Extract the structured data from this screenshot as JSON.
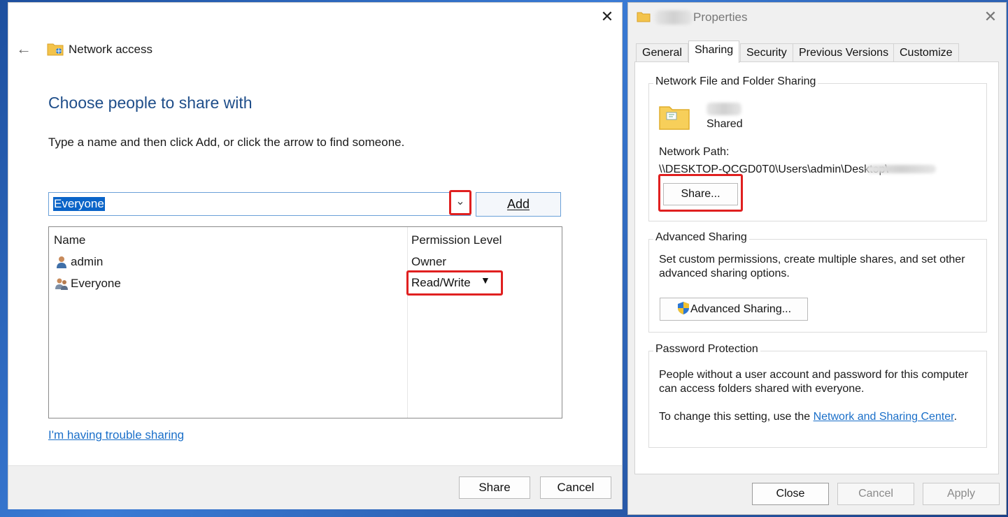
{
  "network_access": {
    "title": "Network access",
    "heading": "Choose people to share with",
    "instruction": "Type a name and then click Add, or click the arrow to find someone.",
    "name_input_value": "Everyone",
    "add_button": "Add",
    "columns": {
      "name": "Name",
      "permission": "Permission Level"
    },
    "users": [
      {
        "name": "admin",
        "permission": "Owner"
      },
      {
        "name": "Everyone",
        "permission": "Read/Write"
      }
    ],
    "trouble_link": "I'm having trouble sharing",
    "share_button": "Share",
    "cancel_button": "Cancel"
  },
  "properties": {
    "title": "Properties",
    "tabs": [
      "General",
      "Sharing",
      "Security",
      "Previous Versions",
      "Customize"
    ],
    "active_tab": "Sharing",
    "network_sharing": {
      "label": "Network File and Folder Sharing",
      "status": "Shared",
      "network_path_label": "Network Path:",
      "network_path": "\\\\DESKTOP-QCGD0T0\\Users\\admin\\Desktop\\",
      "share_button": "Share..."
    },
    "advanced_sharing": {
      "label": "Advanced Sharing",
      "description_line1": "Set custom permissions, create multiple shares, and set other",
      "description_line2": "advanced sharing options.",
      "button": "Advanced Sharing..."
    },
    "password_protection": {
      "label": "Password Protection",
      "description_line1": "People without a user account and password for this computer",
      "description_line2": "can access folders shared with everyone.",
      "change_text": "To change this setting, use the ",
      "link": "Network and Sharing Center",
      "suffix": "."
    },
    "close_button": "Close",
    "cancel_button": "Cancel",
    "apply_button": "Apply"
  },
  "colors": {
    "accent": "#1f4e8a",
    "link": "#1a6fc9",
    "highlight": "#e02020",
    "selection": "#0a64c8"
  }
}
